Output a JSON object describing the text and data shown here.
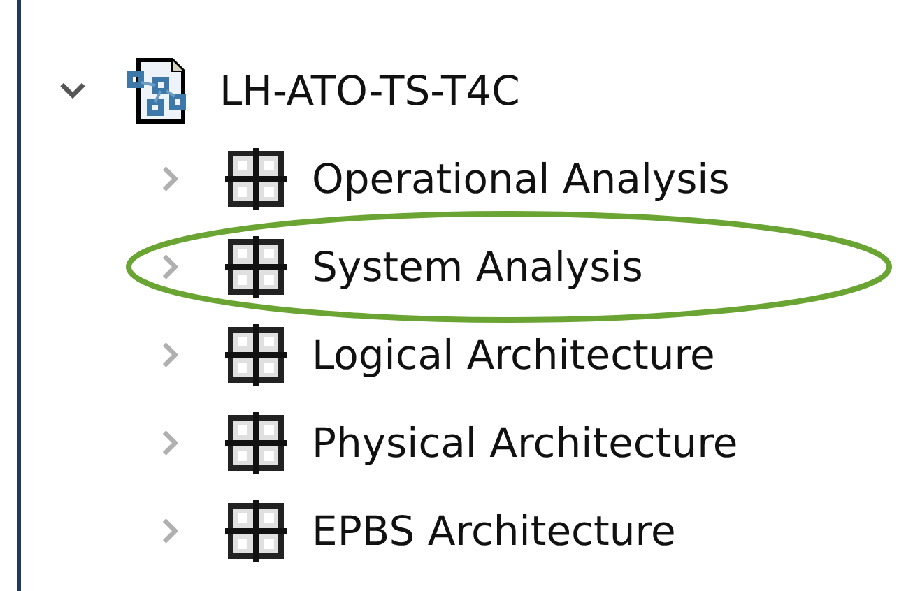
{
  "tree": [
    {
      "label": "LH-ATO-TS-T4C",
      "expanded": true,
      "circled": false,
      "children": [
        {
          "label": "Operational Analysis",
          "expanded": false,
          "circled": false
        },
        {
          "label": "System Analysis",
          "expanded": false,
          "circled": true
        },
        {
          "label": "Logical Architecture",
          "expanded": false,
          "circled": false
        },
        {
          "label": "Physical Architecture",
          "expanded": false,
          "circled": false
        },
        {
          "label": "EPBS Architecture",
          "expanded": false,
          "circled": false
        }
      ]
    }
  ]
}
